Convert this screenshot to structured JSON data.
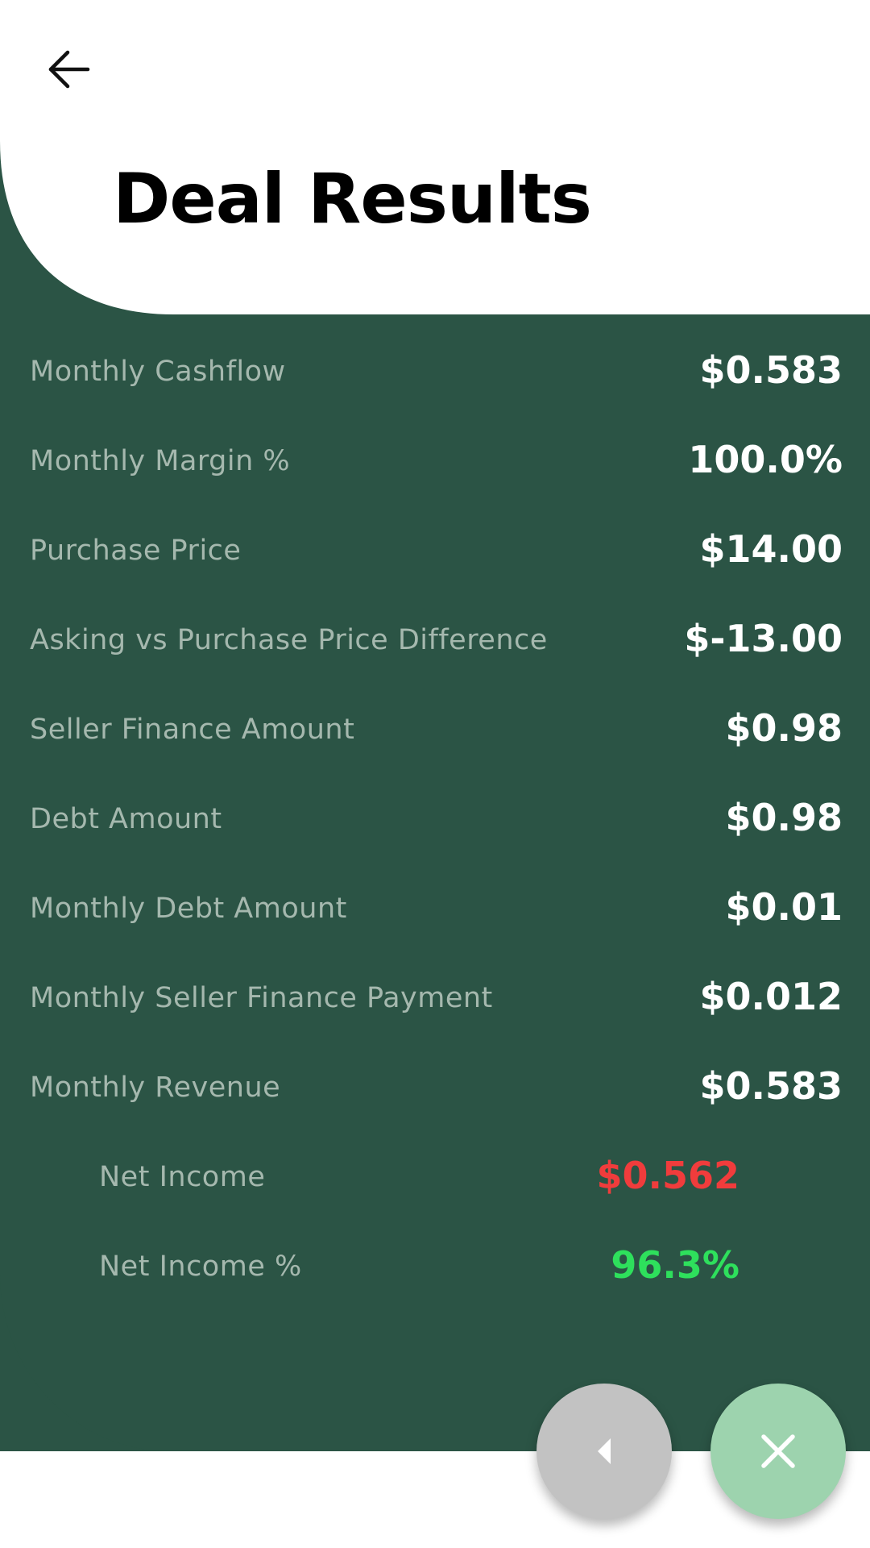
{
  "header": {
    "title": "Deal Results",
    "back_icon": "arrow-left-icon"
  },
  "colors": {
    "panel_background": "#2b5445",
    "label_text": "#a5b8ae",
    "value_text": "#ffffff",
    "negative_value": "#f03c3c",
    "positive_value": "#2ee05c",
    "prev_button": "#c2c2c2",
    "close_button": "#9dd3ae"
  },
  "results": [
    {
      "label": "Monthly Cashflow",
      "value": "$0.583"
    },
    {
      "label": "Monthly Margin %",
      "value": "100.0%"
    },
    {
      "label": "Purchase Price",
      "value": "$14.00"
    },
    {
      "label": "Asking vs Purchase Price Difference",
      "value": "$-13.00"
    },
    {
      "label": "Seller Finance Amount",
      "value": "$0.98"
    },
    {
      "label": "Debt Amount",
      "value": "$0.98"
    },
    {
      "label": "Monthly Debt Amount",
      "value": "$0.01"
    },
    {
      "label": "Monthly Seller Finance Payment",
      "value": "$0.012"
    },
    {
      "label": "Monthly Revenue",
      "value": "$0.583"
    },
    {
      "label": "Net Income",
      "value": "$0.562"
    },
    {
      "label": "Net Income %",
      "value": "96.3%"
    }
  ],
  "actions": {
    "prev_icon": "caret-left-icon",
    "close_icon": "close-icon"
  }
}
